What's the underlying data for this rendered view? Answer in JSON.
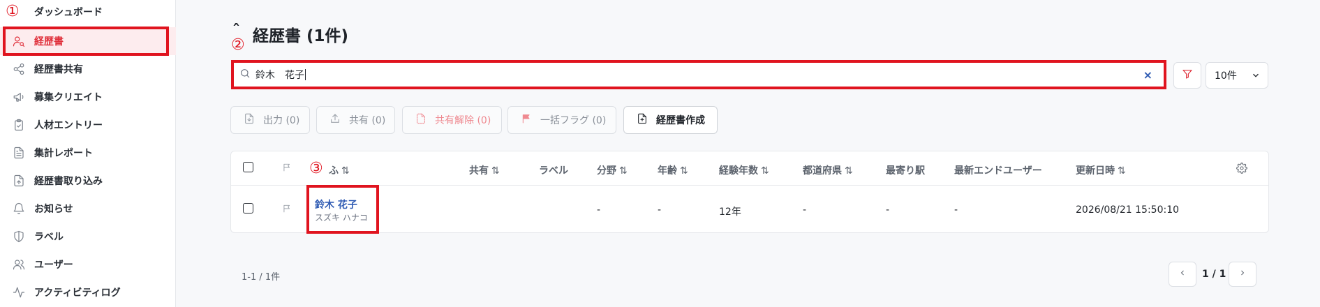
{
  "sidebar": {
    "items": [
      {
        "label": "ダッシュボード",
        "icon": "dashboard-icon"
      },
      {
        "label": "経歴書",
        "icon": "user-search-icon",
        "active": true
      },
      {
        "label": "経歴書共有",
        "icon": "share-icon"
      },
      {
        "label": "募集クリエイト",
        "icon": "megaphone-icon"
      },
      {
        "label": "人材エントリー",
        "icon": "clipboard-icon"
      },
      {
        "label": "集計レポート",
        "icon": "report-icon"
      },
      {
        "label": "経歴書取り込み",
        "icon": "file-upload-icon"
      },
      {
        "label": "お知らせ",
        "icon": "bell-icon"
      },
      {
        "label": "ラベル",
        "icon": "shield-icon"
      },
      {
        "label": "ユーザー",
        "icon": "users-icon"
      },
      {
        "label": "アクティビティログ",
        "icon": "activity-icon"
      }
    ]
  },
  "annotations": {
    "a1": "①",
    "a2": "②",
    "a3": "③"
  },
  "header": {
    "caret": "ˆ",
    "title": "経歴書 (1件)"
  },
  "search": {
    "value": "鈴木　花子",
    "clear": "×"
  },
  "per_page": {
    "selected": "10件"
  },
  "toolbar": {
    "export": "出力 (0)",
    "share": "共有 (0)",
    "unshare": "共有解除 (0)",
    "bulk_flag": "一括フラグ (0)",
    "create": "経歴書作成"
  },
  "table": {
    "headers": {
      "name": "ふ",
      "share": "共有",
      "label": "ラベル",
      "field": "分野",
      "age": "年齢",
      "experience": "経験年数",
      "prefecture": "都道府県",
      "station": "最寄り駅",
      "end_user": "最新エンドユーザー",
      "updated": "更新日時"
    },
    "sort_glyph": "⇅",
    "rows": [
      {
        "name": "鈴木 花子",
        "kana": "スズキ ハナコ",
        "field": "-",
        "age": "-",
        "experience": "12年",
        "prefecture": "-",
        "station": "-",
        "end_user": "-",
        "updated": "2026/08/21 15:50:10"
      }
    ]
  },
  "pagination": {
    "count": "1-1 / 1件",
    "page": "1 / 1"
  },
  "colors": {
    "accent": "#e0313c",
    "highlight": "#e0141f",
    "link": "#2f5bb3"
  }
}
